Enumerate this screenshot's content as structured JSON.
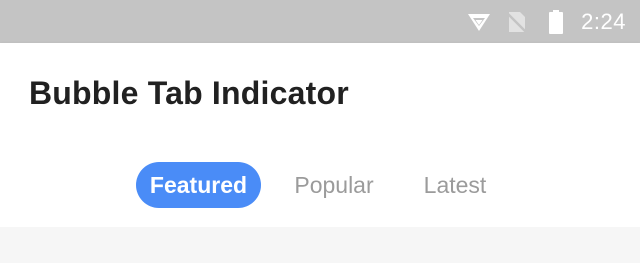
{
  "status_bar": {
    "time": "2:24",
    "icons": [
      "wifi-icon",
      "no-sim-icon",
      "battery-icon"
    ]
  },
  "app_bar": {
    "title": "Bubble Tab Indicator"
  },
  "tabs": [
    {
      "label": "Featured",
      "active": true
    },
    {
      "label": "Popular",
      "active": false
    },
    {
      "label": "Latest",
      "active": false
    }
  ],
  "colors": {
    "status_bar_bg": "#c4c4c4",
    "indicator": "#4a8cf7",
    "inactive_tab_text": "#9b9b9b",
    "title_text": "#212121"
  }
}
